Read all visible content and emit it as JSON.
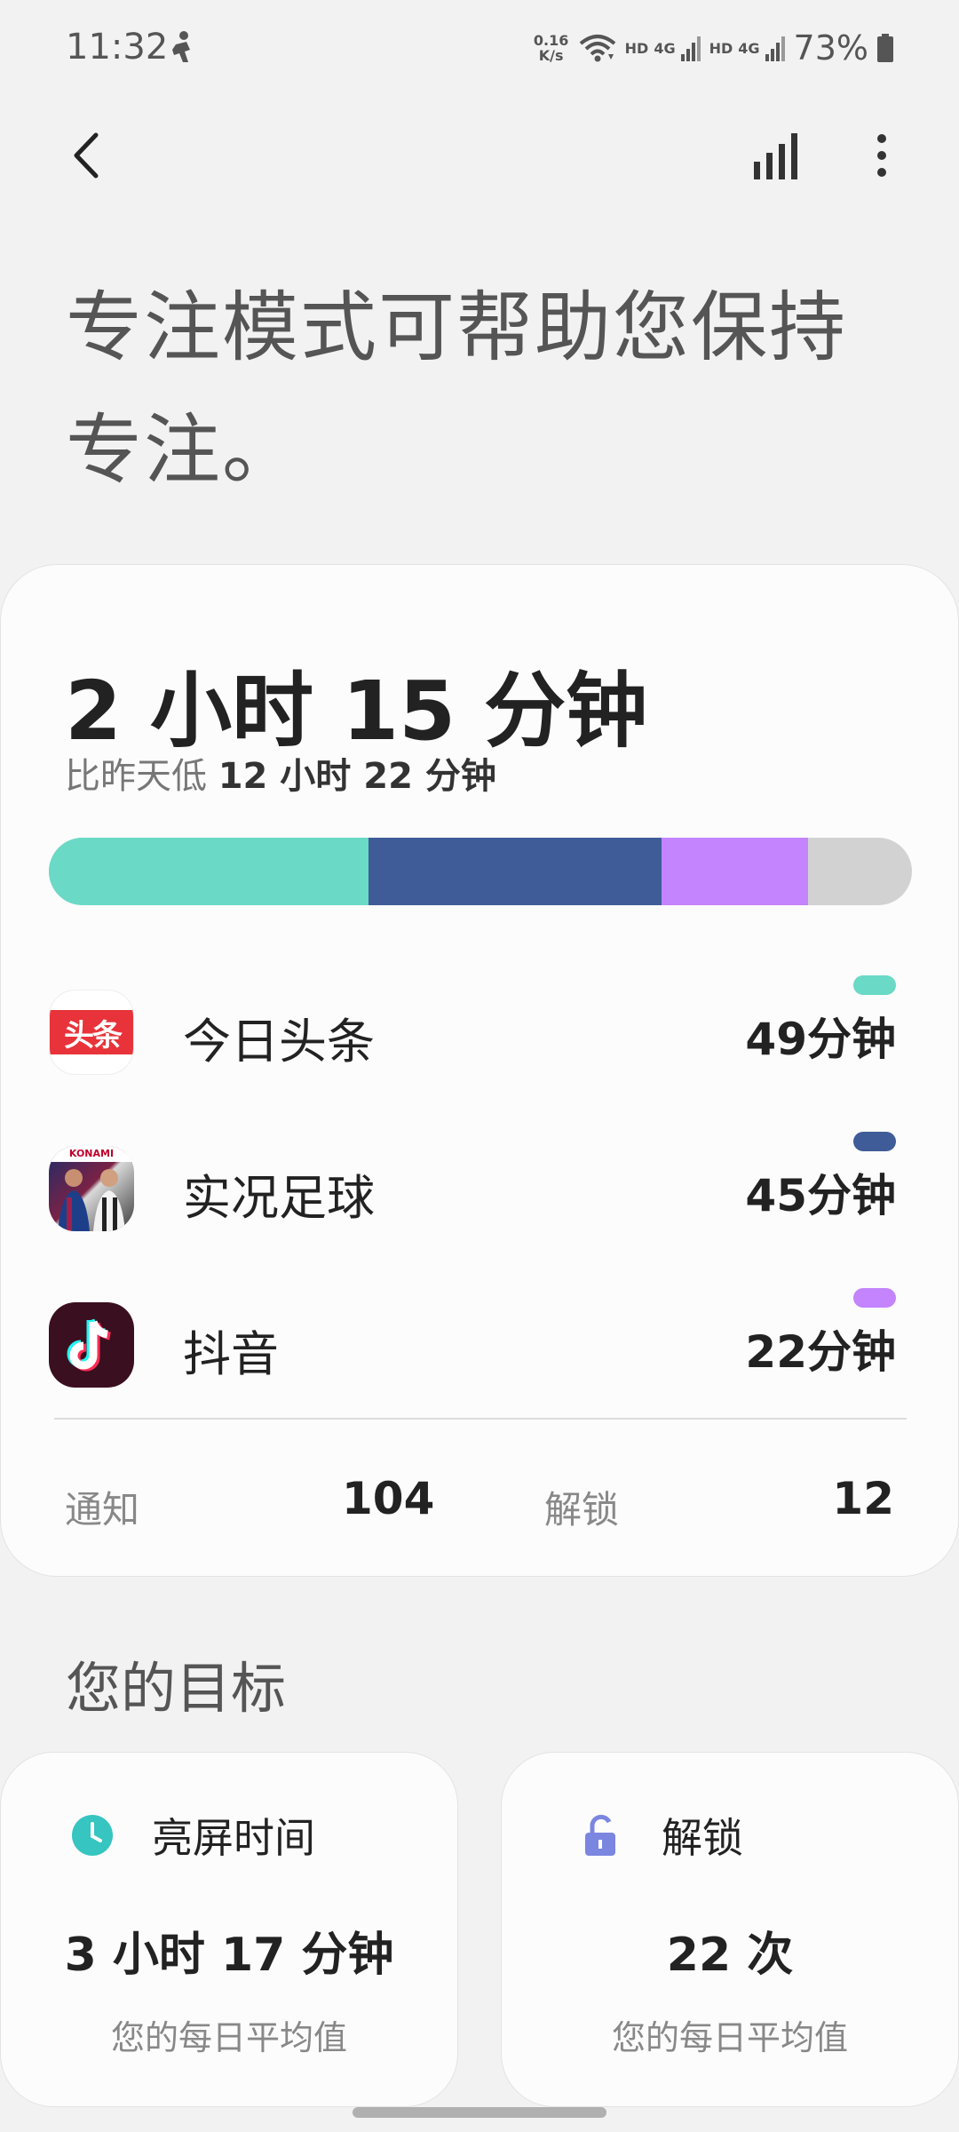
{
  "status_bar": {
    "time": "11:32",
    "net_speed_value": "0.16",
    "net_speed_unit": "K/s",
    "hd1": "HD",
    "net1": "4G",
    "hd2": "HD",
    "net2": "4G",
    "battery": "73%"
  },
  "headline": "专注模式可帮助您保持专注。",
  "usage": {
    "total_time": "2 小时 15 分钟",
    "compare_prefix": "比昨天低 ",
    "compare_value": "12 小时 22 分钟",
    "bar_segments": [
      {
        "color": "#6ad9c6",
        "fraction": 0.37
      },
      {
        "color": "#3f5c99",
        "fraction": 0.34
      },
      {
        "color": "#c384fd",
        "fraction": 0.17
      }
    ],
    "bar_remainder_color": "#d2d2d2",
    "apps": [
      {
        "name": "今日头条",
        "time": "49分钟",
        "color": "#6ad9c6",
        "icon": "toutiao-icon",
        "icon_text": "头条"
      },
      {
        "name": "实况足球",
        "time": "45分钟",
        "color": "#3f5c99",
        "icon": "efootball-icon",
        "icon_text": "KONAMI"
      },
      {
        "name": "抖音",
        "time": "22分钟",
        "color": "#c384fd",
        "icon": "douyin-icon"
      }
    ],
    "notifications_label": "通知",
    "notifications_value": "104",
    "unlocks_label": "解锁",
    "unlocks_value": "12"
  },
  "goals": {
    "title": "您的目标",
    "screen_time": {
      "label": "亮屏时间",
      "value": "3 小时 17 分钟",
      "sub": "您的每日平均值",
      "icon": "clock-icon",
      "icon_color": "#36c5c0"
    },
    "unlocks": {
      "label": "解锁",
      "value": "22 次",
      "sub": "您的每日平均值",
      "icon": "unlock-icon",
      "icon_color": "#7b86e0"
    }
  }
}
